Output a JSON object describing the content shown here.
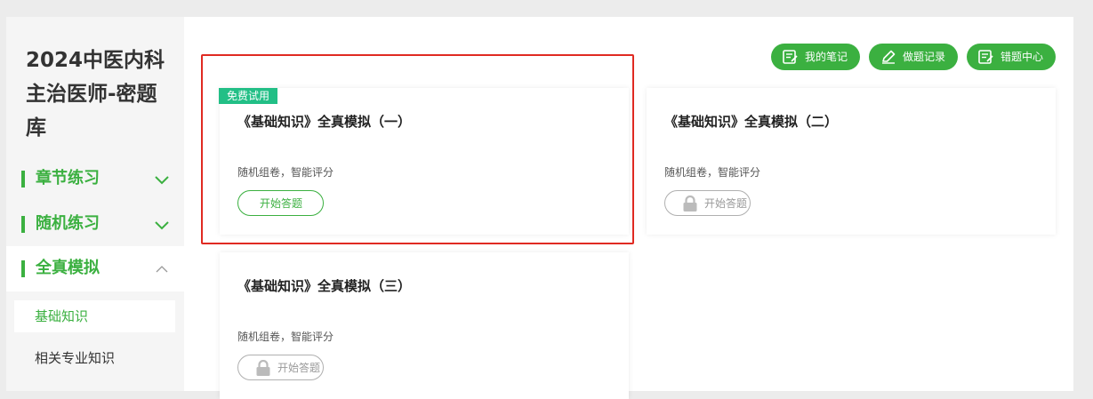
{
  "app_title": "2024中医内科主治医师-密题库",
  "sidebar": {
    "sections": [
      {
        "label": "章节练习",
        "expanded": false
      },
      {
        "label": "随机练习",
        "expanded": false
      },
      {
        "label": "全真模拟",
        "expanded": true
      }
    ],
    "sub_items": [
      {
        "label": "基础知识",
        "selected": true
      },
      {
        "label": "相关专业知识",
        "selected": false
      }
    ]
  },
  "toolbar": {
    "notes_label": "我的笔记",
    "records_label": "做题记录",
    "wrong_label": "错题中心"
  },
  "cards": [
    {
      "title": "《基础知识》全真模拟（一）",
      "desc": "随机组卷，智能评分",
      "button": "开始答题",
      "badge": "免费试用",
      "locked": false
    },
    {
      "title": "《基础知识》全真模拟（二）",
      "desc": "随机组卷，智能评分",
      "button": "开始答题",
      "locked": true
    },
    {
      "title": "《基础知识》全真模拟（三）",
      "desc": "随机组卷，智能评分",
      "button": "开始答题",
      "locked": true
    }
  ],
  "colors": {
    "accent": "#3bb040",
    "badge": "#22bf86",
    "highlight": "#e02a22"
  },
  "icons": [
    "note-icon",
    "pencil-icon",
    "wrong-book-icon",
    "chevron-down-icon",
    "chevron-up-icon",
    "lock-icon"
  ]
}
